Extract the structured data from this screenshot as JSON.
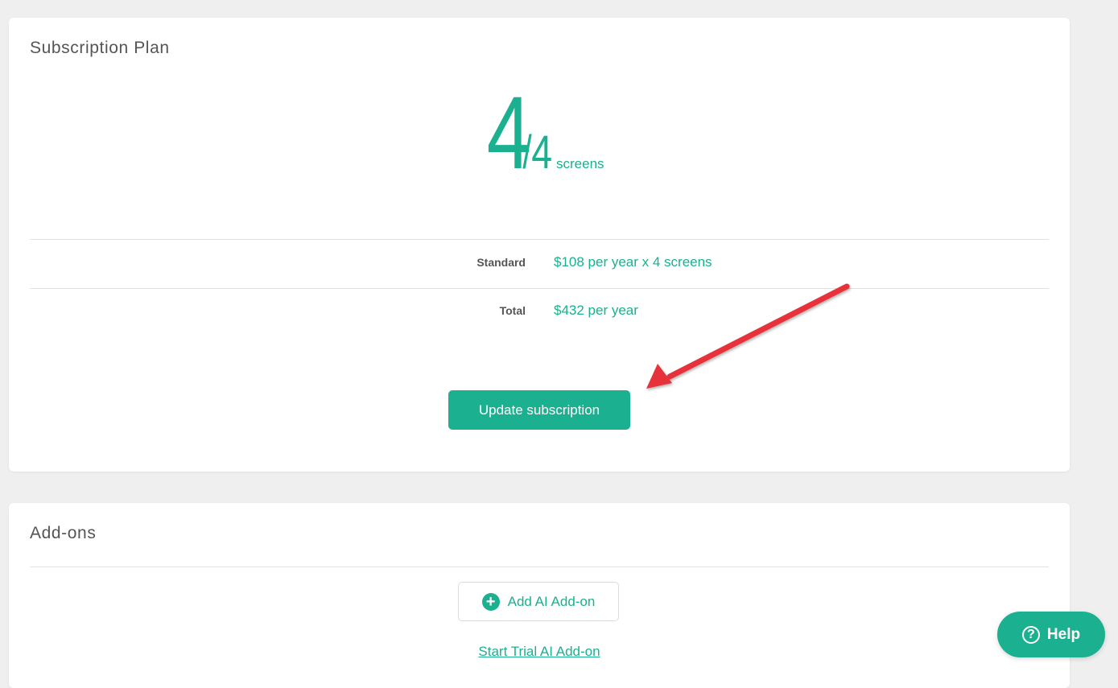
{
  "plan": {
    "title": "Subscription Plan",
    "screens_used": "4",
    "slash": "/",
    "screens_total": "4",
    "screens_unit": "screens",
    "rows": [
      {
        "label": "Standard",
        "value": "$108 per year x 4 screens"
      },
      {
        "label": "Total",
        "value": "$432 per year"
      }
    ],
    "update_button": "Update subscription"
  },
  "addons": {
    "title": "Add-ons",
    "add_button": "Add AI Add-on",
    "add_icon": "plus-circle-icon",
    "trial_link": "Start Trial AI Add-on"
  },
  "help": {
    "label": "Help",
    "icon_glyph": "?",
    "icon": "question-circle-icon"
  },
  "colors": {
    "accent": "#1bb08f",
    "arrow": "#e8333b"
  }
}
